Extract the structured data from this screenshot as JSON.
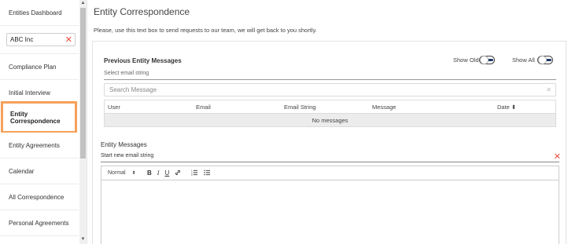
{
  "sidebar": {
    "items": [
      {
        "label": "Entities Dashboard"
      },
      {
        "label": "Compliance Plan"
      },
      {
        "label": "Initial Interview"
      },
      {
        "label": "Entity Correspondence"
      },
      {
        "label": "Entity Agreements"
      },
      {
        "label": "Calendar"
      },
      {
        "label": "All Correspondence"
      },
      {
        "label": "Personal Agreements"
      }
    ],
    "entity_filter_value": "ABC Inc",
    "active_item": "Entity Correspondence"
  },
  "main": {
    "title": "Entity Correspondence",
    "description": "Please, use this text box to send requests to our team, we will get back to you shortly.",
    "previous": {
      "title": "Previous Entity Messages",
      "show_old_label": "Show Old",
      "show_all_label": "Show All",
      "select_placeholder": "Select email string",
      "search_placeholder": "Search Message",
      "columns": [
        "User",
        "Email",
        "Email String",
        "Message",
        "Date ⬍"
      ],
      "empty_text": "No messages"
    },
    "compose": {
      "title": "Entity Messages",
      "new_string_placeholder": "Start new email string",
      "toolbar": {
        "format_value": "Normal",
        "bold": "B",
        "italic": "I",
        "underline": "U",
        "link": "🔗",
        "ordered_list": "☷",
        "bullet_list": "☰"
      }
    }
  },
  "colors": {
    "active_border": "#f5a05a",
    "toggle_dark": "#1f3a68",
    "clear_red": "#e74c3c"
  }
}
